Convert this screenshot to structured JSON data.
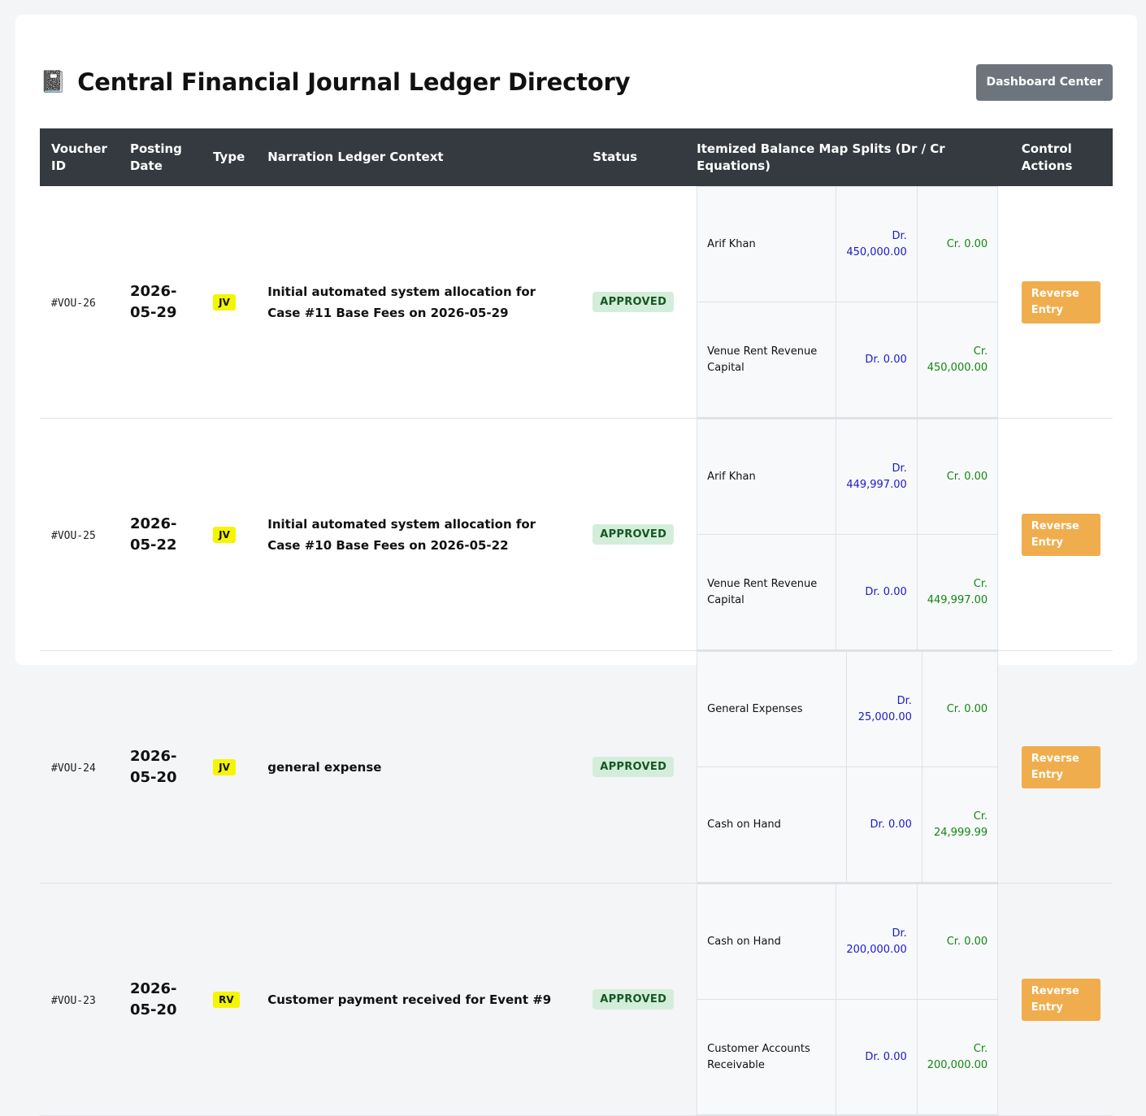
{
  "header": {
    "icon": "book-icon",
    "icon_glyph": "📓",
    "title": "Central Financial Journal Ledger Directory",
    "dashboard_button": "Dashboard Center"
  },
  "table": {
    "columns": [
      "Voucher ID",
      "Posting Date",
      "Type",
      "Narration Ledger Context",
      "Status",
      "Itemized Balance Map Splits (Dr / Cr Equations)",
      "Control Actions"
    ],
    "rows": [
      {
        "voucher_id": "#VOU-26",
        "date": "2026-05-29",
        "type": "JV",
        "narration": "Initial automated system allocation for Case #11 Base Fees on 2026-05-29",
        "status": "APPROVED",
        "splits": [
          {
            "account": "Arif Khan",
            "dr": "Dr. 450,000.00",
            "cr": "Cr. 0.00"
          },
          {
            "account": "Venue Rent Revenue Capital",
            "dr": "Dr. 0.00",
            "cr": "Cr. 450,000.00"
          }
        ],
        "action": "Reverse Entry"
      },
      {
        "voucher_id": "#VOU-25",
        "date": "2026-05-22",
        "type": "JV",
        "narration": "Initial automated system allocation for Case #10 Base Fees on 2026-05-22",
        "status": "APPROVED",
        "splits": [
          {
            "account": "Arif Khan",
            "dr": "Dr. 449,997.00",
            "cr": "Cr. 0.00"
          },
          {
            "account": "Venue Rent Revenue Capital",
            "dr": "Dr. 0.00",
            "cr": "Cr. 449,997.00"
          }
        ],
        "action": "Reverse Entry"
      },
      {
        "voucher_id": "#VOU-24",
        "date": "2026-05-20",
        "type": "JV",
        "narration": "general expense",
        "status": "APPROVED",
        "splits": [
          {
            "account": "General Expenses",
            "dr": "Dr. 25,000.00",
            "cr": "Cr. 0.00"
          },
          {
            "account": "Cash on Hand",
            "dr": "Dr. 0.00",
            "cr": "Cr. 24,999.99"
          }
        ],
        "action": "Reverse Entry"
      },
      {
        "voucher_id": "#VOU-23",
        "date": "2026-05-20",
        "type": "RV",
        "narration": "Customer payment received for Event #9",
        "status": "APPROVED",
        "splits": [
          {
            "account": "Cash on Hand",
            "dr": "Dr. 200,000.00",
            "cr": "Cr. 0.00"
          },
          {
            "account": "Customer Accounts Receivable",
            "dr": "Dr. 0.00",
            "cr": "Cr. 200,000.00"
          }
        ],
        "action": "Reverse Entry"
      }
    ]
  },
  "colors": {
    "header_bg": "#343a40",
    "type_badge": "#f5f500",
    "status_bg": "#d4edda",
    "status_text": "#155724",
    "dr_text": "#1a1acc",
    "cr_text": "#138613",
    "reverse_button": "#f0ad4e",
    "dashboard_button": "#6c757d"
  }
}
